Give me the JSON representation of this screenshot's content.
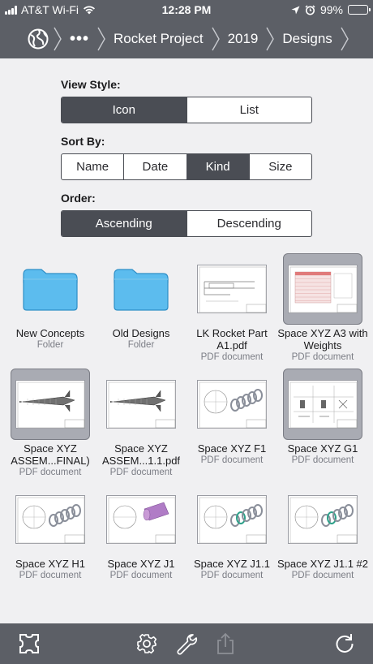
{
  "status": {
    "carrier": "AT&T Wi-Fi",
    "time": "12:28 PM",
    "battery": "99%"
  },
  "nav": {
    "more": "•••",
    "crumbs": [
      "Rocket Project",
      "2019",
      "Designs"
    ]
  },
  "options": {
    "view_style": {
      "label": "View Style:",
      "items": [
        "Icon",
        "List"
      ],
      "selected": 0
    },
    "sort_by": {
      "label": "Sort By:",
      "items": [
        "Name",
        "Date",
        "Kind",
        "Size"
      ],
      "selected": 2
    },
    "order": {
      "label": "Order:",
      "items": [
        "Ascending",
        "Descending"
      ],
      "selected": 0
    }
  },
  "files": [
    {
      "name": "New Concepts",
      "kind": "Folder",
      "icon": "folder-icon",
      "selected": false
    },
    {
      "name": "Old Designs",
      "kind": "Folder",
      "icon": "folder-icon",
      "selected": false
    },
    {
      "name": "LK Rocket Part A1.pdf",
      "kind": "PDF document",
      "icon": "pdf-drawing-icon",
      "selected": false
    },
    {
      "name": "Space XYZ A3 with Weights",
      "kind": "PDF document",
      "icon": "pdf-table-icon",
      "selected": true
    },
    {
      "name": "Space XYZ ASSEM...FINAL)",
      "kind": "PDF document",
      "icon": "pdf-rocket-icon",
      "selected": true
    },
    {
      "name": "Space XYZ ASSEM...1.1.pdf",
      "kind": "PDF document",
      "icon": "pdf-rocket-icon",
      "selected": false
    },
    {
      "name": "Space XYZ F1",
      "kind": "PDF document",
      "icon": "pdf-springs-icon",
      "selected": false
    },
    {
      "name": "Space XYZ G1",
      "kind": "PDF document",
      "icon": "pdf-parts-icon",
      "selected": true
    },
    {
      "name": "Space XYZ H1",
      "kind": "PDF document",
      "icon": "pdf-springs-icon",
      "selected": false
    },
    {
      "name": "Space XYZ J1",
      "kind": "PDF document",
      "icon": "pdf-cylinder-icon",
      "selected": false
    },
    {
      "name": "Space XYZ J1.1",
      "kind": "PDF document",
      "icon": "pdf-springs-green-icon",
      "selected": false
    },
    {
      "name": "Space XYZ J1.1 #2",
      "kind": "PDF document",
      "icon": "pdf-springs-green-icon",
      "selected": false
    }
  ],
  "toolbar": {
    "icons": [
      "fullscreen-icon",
      "gear-icon",
      "wrench-icon",
      "share-icon",
      "refresh-icon"
    ]
  },
  "colors": {
    "bar": "#5c5f66",
    "selected_segment": "#4a4d54",
    "folder": "#5cbcee"
  }
}
